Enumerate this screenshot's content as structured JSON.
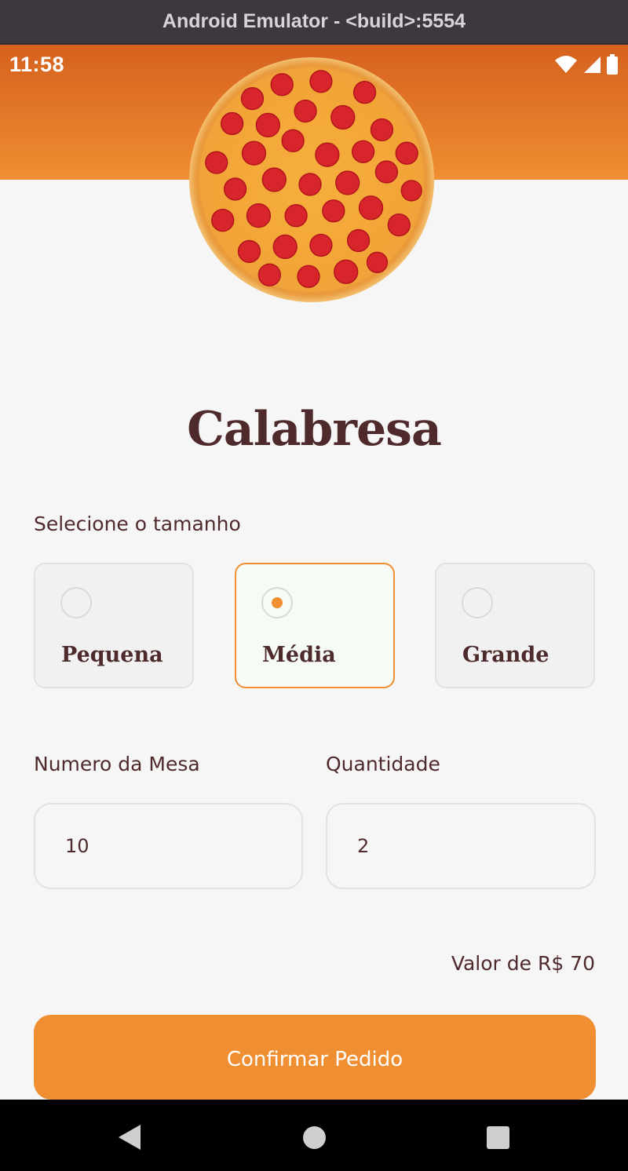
{
  "window": {
    "title": "Android Emulator - <build>:5554"
  },
  "status_bar": {
    "time": "11:58",
    "icons": [
      "wifi-icon",
      "signal-icon",
      "battery-icon"
    ]
  },
  "product": {
    "name": "Calabresa",
    "image": "pizza-image"
  },
  "size_section": {
    "label": "Selecione o tamanho",
    "options": [
      {
        "label": "Pequena",
        "selected": false
      },
      {
        "label": "Média",
        "selected": true
      },
      {
        "label": "Grande",
        "selected": false
      }
    ]
  },
  "table": {
    "label": "Numero da Mesa",
    "value": "10"
  },
  "quantity": {
    "label": "Quantidade",
    "value": "2"
  },
  "price": {
    "text": "Valor de R$ 70"
  },
  "confirm": {
    "label": "Confirmar Pedido"
  },
  "colors": {
    "accent": "#f08e32",
    "header_top": "#d5611e",
    "text_dark": "#4f2a2c",
    "background": "#f6f6f6"
  },
  "nav": {
    "icons": [
      "back-icon",
      "home-icon",
      "recents-icon"
    ]
  }
}
